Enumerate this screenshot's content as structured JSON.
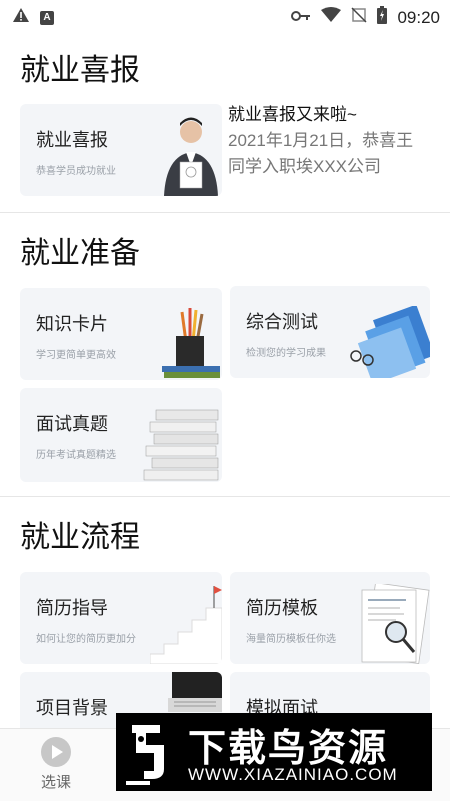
{
  "status_bar": {
    "time": "09:20"
  },
  "sections": {
    "news": {
      "title": "就业喜报"
    },
    "prep": {
      "title": "就业准备"
    },
    "process": {
      "title": "就业流程"
    }
  },
  "news_card": {
    "title": "就业喜报",
    "subtitle": "恭喜学员成功就业",
    "headline": "就业喜报又来啦~",
    "body_line1": "2021年1月21日，恭喜王",
    "body_line2": "同学入职埃XXX公司"
  },
  "prep_cards": [
    {
      "title": "知识卡片",
      "subtitle": "学习更简单更高效"
    },
    {
      "title": "综合测试",
      "subtitle": "检测您的学习成果"
    },
    {
      "title": "面试真题",
      "subtitle": "历年考试真题精选"
    }
  ],
  "process_cards": [
    {
      "title": "简历指导",
      "subtitle": "如何让您的简历更加分"
    },
    {
      "title": "简历模板",
      "subtitle": "海量简历模板任你选"
    },
    {
      "title": "项目背景",
      "subtitle": ""
    },
    {
      "title": "模拟面试",
      "subtitle": ""
    }
  ],
  "bottom_nav": {
    "tab1_label": "选课"
  },
  "watermark": {
    "title": "下载鸟资源",
    "url": "WWW.XIAZAINIAO.COM"
  }
}
